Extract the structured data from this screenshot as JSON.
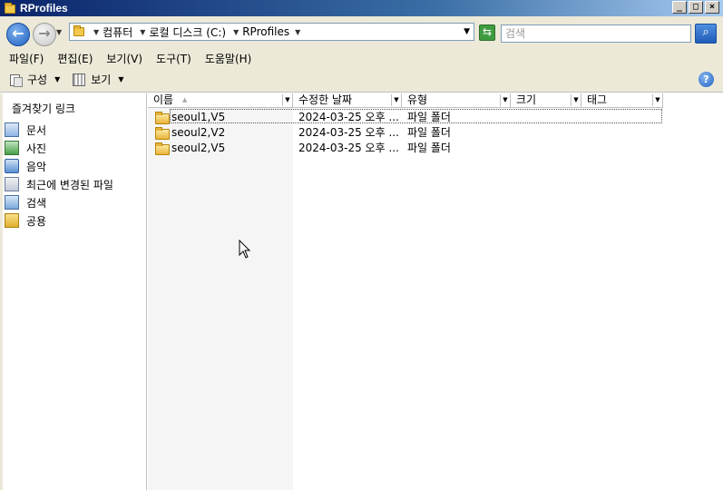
{
  "window": {
    "title": "RProfiles",
    "minimize_label": "_",
    "maximize_label": "□",
    "close_label": "×"
  },
  "address": {
    "crumbs": [
      "컴퓨터",
      "로컬 디스크 (C:)",
      "RProfiles"
    ],
    "search_placeholder": "검색"
  },
  "menu": [
    "파일(F)",
    "편집(E)",
    "보기(V)",
    "도구(T)",
    "도움말(H)"
  ],
  "toolbar": {
    "organize_label": "구성",
    "view_label": "보기"
  },
  "nav": {
    "header": "즐겨찾기 링크",
    "items": [
      {
        "label": "문서",
        "icon": "documents-icon"
      },
      {
        "label": "사진",
        "icon": "pictures-icon"
      },
      {
        "label": "음악",
        "icon": "music-icon"
      },
      {
        "label": "최근에 변경된 파일",
        "icon": "recent-files-icon"
      },
      {
        "label": "검색",
        "icon": "searches-icon"
      },
      {
        "label": "공용",
        "icon": "public-folder-icon"
      }
    ]
  },
  "columns": [
    "이름",
    "수정한 날짜",
    "유형",
    "크기",
    "태그"
  ],
  "files": [
    {
      "name": "seoul1,V5",
      "date": "2024-03-25 오후 ...",
      "type": "파일 폴더"
    },
    {
      "name": "seoul2,V2",
      "date": "2024-03-25 오후 ...",
      "type": "파일 폴더"
    },
    {
      "name": "seoul2,V5",
      "date": "2024-03-25 오후 ...",
      "type": "파일 폴더"
    }
  ]
}
